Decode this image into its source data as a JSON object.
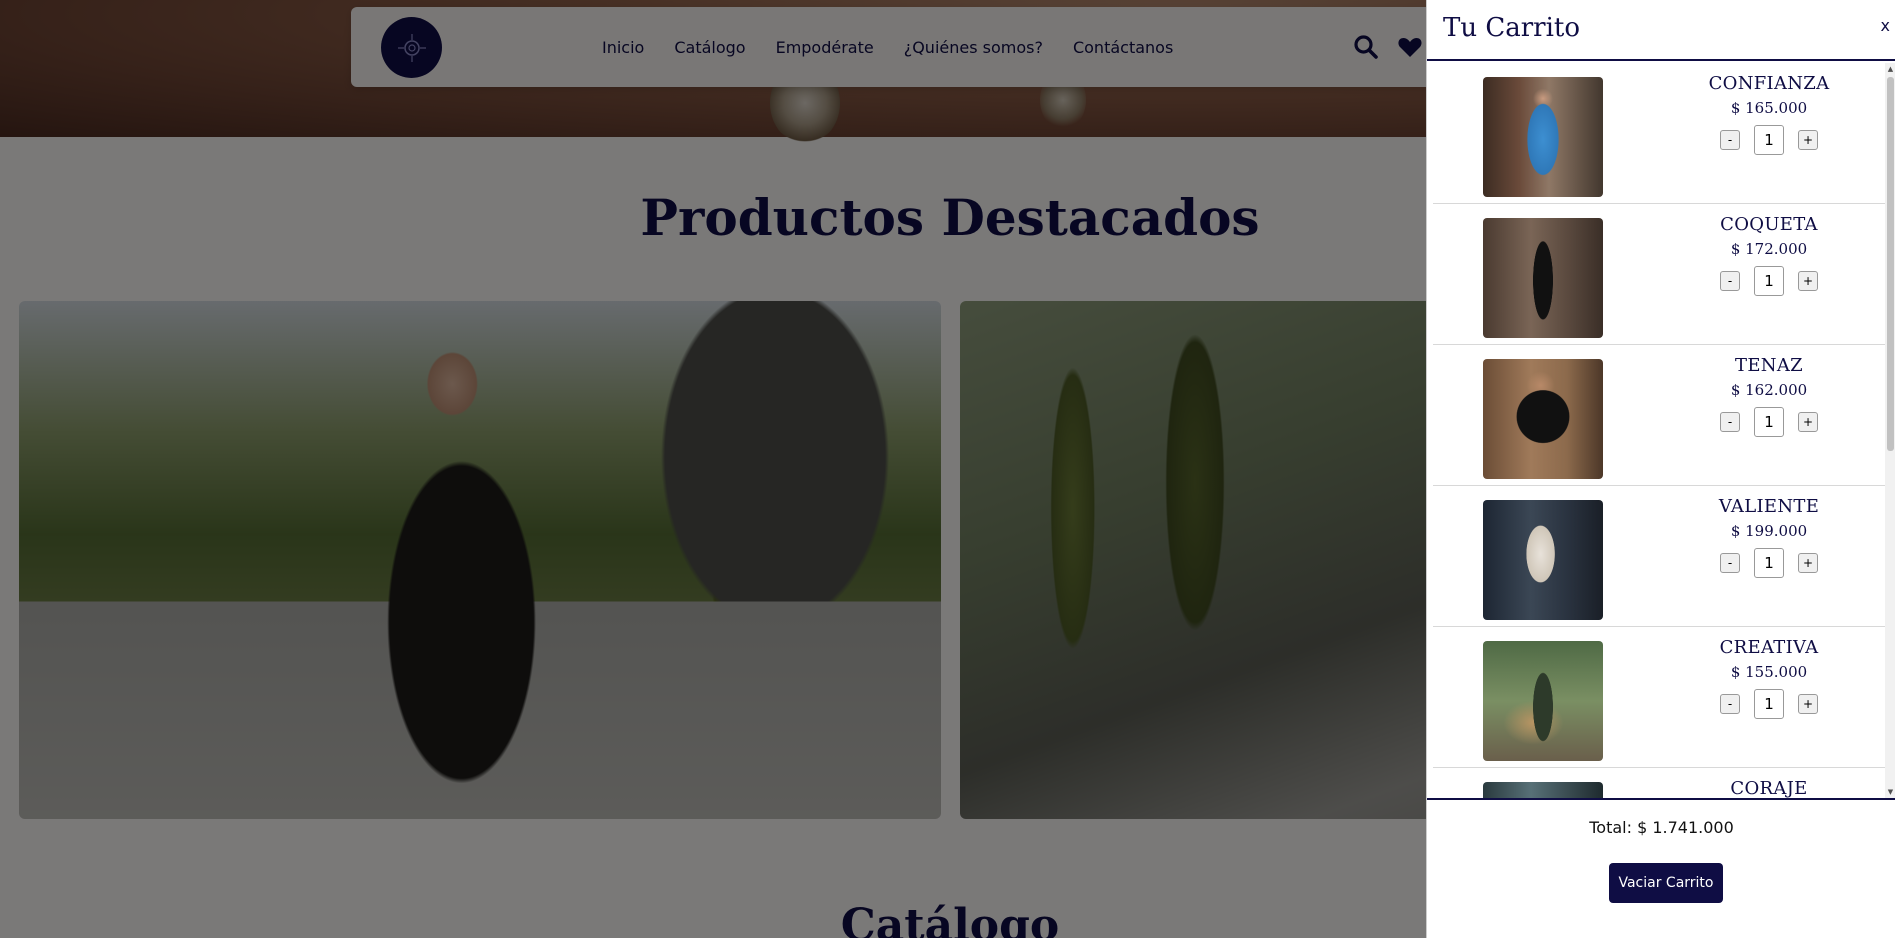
{
  "nav": {
    "links": [
      "Inicio",
      "Catálogo",
      "Empodérate",
      "¿Quiénes somos?",
      "Contáctanos"
    ]
  },
  "sections": {
    "featured_title": "Productos Destacados",
    "catalog_title": "Catálogo"
  },
  "cart": {
    "title": "Tu Carrito",
    "close_label": "x",
    "items": [
      {
        "name": "CONFIANZA",
        "price": "$ 165.000",
        "quantity": "1"
      },
      {
        "name": "COQUETA",
        "price": "$ 172.000",
        "quantity": "1"
      },
      {
        "name": "TENAZ",
        "price": "$ 162.000",
        "quantity": "1"
      },
      {
        "name": "VALIENTE",
        "price": "$ 199.000",
        "quantity": "1"
      },
      {
        "name": "CREATIVA",
        "price": "$ 155.000",
        "quantity": "1"
      },
      {
        "name": "CORAJE",
        "price": "",
        "quantity": ""
      }
    ],
    "decrement_label": "-",
    "increment_label": "+",
    "total": "Total: $ 1.741.000",
    "empty_button": "Vaciar Carrito"
  },
  "colors": {
    "brand": "#0f0d44",
    "overlay": "rgba(0,0,0,0.5)"
  },
  "icons": [
    "logo-icon",
    "search-icon",
    "heart-icon"
  ]
}
